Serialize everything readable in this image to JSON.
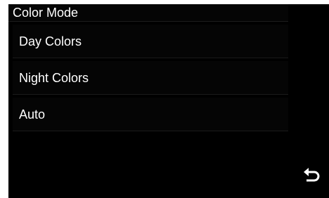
{
  "screen": {
    "title": "Color Mode"
  },
  "menu": {
    "items": [
      {
        "label": "Day Colors"
      },
      {
        "label": "Night Colors"
      },
      {
        "label": "Auto"
      }
    ]
  },
  "controls": {
    "back_icon": "back-arrow-icon"
  },
  "colors": {
    "background": "#000000",
    "text": "#ffffff",
    "divider": "#1a1a1a"
  }
}
